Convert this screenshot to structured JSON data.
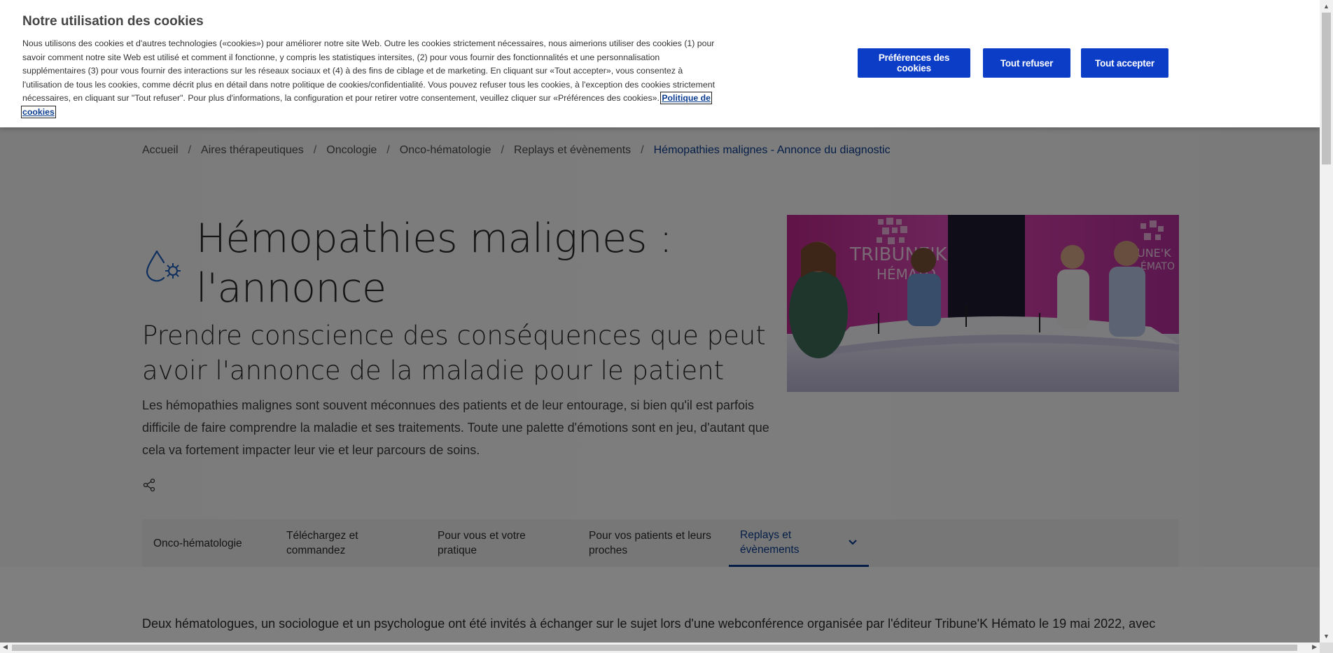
{
  "cookie_banner": {
    "title": "Notre utilisation des cookies",
    "description": "Nous utilisons des cookies et d'autres technologies («cookies») pour améliorer notre site Web. Outre les cookies strictement nécessaires, nous aimerions utiliser des cookies (1) pour savoir comment notre site Web est utilisé et comment il fonctionne, y compris les statistiques intersites, (2) pour vous fournir des fonctionnalités et une personnalisation supplémentaires (3) pour vous fournir des interactions sur les réseaux sociaux et (4) à des fins de ciblage et de marketing. En cliquant sur «Tout accepter», vous consentez à l'utilisation de tous les cookies, comme décrit plus en détail dans notre politique de cookies/confidentialité. Vous pouvez refuser tous les cookies, à l'exception des cookies strictement nécessaires, en cliquant sur \"Tout refuser\". Pour plus d'informations, la configuration et pour retirer votre consentement, veuillez cliquer sur «Préférences des cookies».",
    "policy_link": "Politique de cookies",
    "buttons": {
      "preferences": "Préférences des cookies",
      "refuse_all": "Tout refuser",
      "accept_all": "Tout accepter"
    },
    "button_color": "#0b3dc6"
  },
  "breadcrumb": {
    "items": [
      "Accueil",
      "Aires thérapeutiques",
      "Oncologie",
      "Onco-hématologie",
      "Replays et évènements"
    ],
    "separator": "/",
    "current": "Hémopathies malignes - Annonce du diagnostic"
  },
  "hero": {
    "title_line1": "Hémopathies malignes :",
    "title_line2": "l'annonce",
    "subtitle": "Prendre conscience des conséquences que peut avoir l'annonce de la maladie pour le patient",
    "lead": "Les hémopathies malignes sont souvent méconnues des patients et de leur entourage, si bien qu'il est parfois difficile de faire comprendre la maladie et ses traitements. Toute une palette d'émotions sont en jeu, d'autant que cela va fortement impacter leur vie et leur parcours de soins.",
    "icon": "blood-drop-virus-icon",
    "image_brand_text": {
      "left_line1": "TRIBUNE'K",
      "left_line2": "HÉMATO",
      "right_line1": "UNE'K",
      "right_line2": "ÉMATO"
    }
  },
  "subnav": {
    "tabs": [
      {
        "label": "Onco-hématologie"
      },
      {
        "label": "Téléchargez et commandez"
      },
      {
        "label": "Pour vous et votre pratique"
      },
      {
        "label": "Pour vos patients et leurs proches"
      },
      {
        "label": "Replays et évènements",
        "active": true
      }
    ],
    "accent_color": "#0b3d91"
  },
  "content": {
    "intro": "Deux hématologues, un sociologue et un psychologue ont été invités à échanger sur le sujet lors d'une webconférence organisée par l'éditeur Tribune'K Hémato le 19 mai 2022, avec"
  }
}
